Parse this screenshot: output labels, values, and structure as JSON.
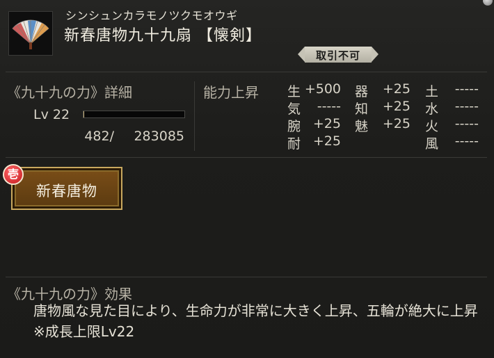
{
  "item": {
    "kana": "シンシュンカラモノツクモオウギ",
    "name": "新春唐物九十九扇 【懐剣】",
    "trade_status": "取引不可",
    "icon": "folding-fan-icon"
  },
  "power": {
    "title": "《九十九の力》詳細",
    "level": "Lv 22",
    "exp_current": "482/",
    "exp_max": "283085",
    "exp_fraction": 0.0017
  },
  "stats": {
    "title": "能力上昇",
    "rows": [
      [
        "生",
        "+500",
        "器",
        "+25",
        "土",
        "-----"
      ],
      [
        "気",
        "-----",
        "知",
        "+25",
        "水",
        "-----"
      ],
      [
        "腕",
        "+25",
        "魅",
        "+25",
        "火",
        "-----"
      ],
      [
        "耐",
        "+25",
        "",
        "",
        "風",
        "-----"
      ]
    ]
  },
  "skill": {
    "seal": "壱",
    "label": "新春唐物"
  },
  "effect": {
    "title": "《九十九の力》効果",
    "body": "唐物風な見た目により、生命力が非常に大きく上昇、五輪が絶大に上昇 ※成長上限Lv22"
  },
  "colors": {
    "accent_gold": "#c9a85e",
    "skill_brown": "#6b4414",
    "seal_red": "#c4161b"
  }
}
